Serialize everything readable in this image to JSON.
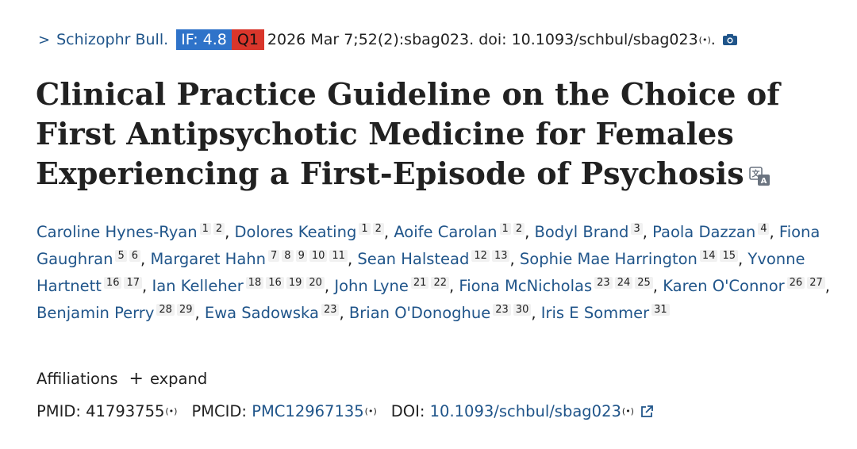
{
  "citation": {
    "chevron": ">",
    "journal": "Schizophr Bull.",
    "if_badge": "IF: 4.8",
    "q_badge": "Q1",
    "text": "2026 Mar 7;52(2):sbag023. doi: 10.1093/schbul/sbag023",
    "broadcast": "(•)",
    "trailing": "."
  },
  "title": "Clinical Practice Guideline on the Choice of First Antipsychotic Medicine for Females Experiencing a First-Episode of Psychosis",
  "authors": [
    {
      "name": "Caroline Hynes-Ryan",
      "affils": [
        "1",
        "2"
      ]
    },
    {
      "name": "Dolores Keating",
      "affils": [
        "1",
        "2"
      ]
    },
    {
      "name": "Aoife Carolan",
      "affils": [
        "1",
        "2"
      ]
    },
    {
      "name": "Bodyl Brand",
      "affils": [
        "3"
      ]
    },
    {
      "name": "Paola Dazzan",
      "affils": [
        "4"
      ]
    },
    {
      "name": "Fiona Gaughran",
      "affils": [
        "5",
        "6"
      ]
    },
    {
      "name": "Margaret Hahn",
      "affils": [
        "7",
        "8",
        "9",
        "10",
        "11"
      ]
    },
    {
      "name": "Sean Halstead",
      "affils": [
        "12",
        "13"
      ]
    },
    {
      "name": "Sophie Mae Harrington",
      "affils": [
        "14",
        "15"
      ]
    },
    {
      "name": "Yvonne Hartnett",
      "affils": [
        "16",
        "17"
      ]
    },
    {
      "name": "Ian Kelleher",
      "affils": [
        "18",
        "16",
        "19",
        "20"
      ]
    },
    {
      "name": "John Lyne",
      "affils": [
        "21",
        "22"
      ]
    },
    {
      "name": "Fiona McNicholas",
      "affils": [
        "23",
        "24",
        "25"
      ]
    },
    {
      "name": "Karen O'Connor",
      "affils": [
        "26",
        "27"
      ]
    },
    {
      "name": "Benjamin Perry",
      "affils": [
        "28",
        "29"
      ]
    },
    {
      "name": "Ewa Sadowska",
      "affils": [
        "23"
      ]
    },
    {
      "name": "Brian O'Donoghue",
      "affils": [
        "23",
        "30"
      ]
    },
    {
      "name": "Iris E Sommer",
      "affils": [
        "31"
      ]
    }
  ],
  "affiliations": {
    "label": "Affiliations",
    "expand_label": "expand",
    "plus": "+"
  },
  "ids": {
    "pmid_label": "PMID:",
    "pmid": "41793755",
    "pmcid_label": "PMCID:",
    "pmcid": "PMC12967135",
    "doi_label": "DOI:",
    "doi": "10.1093/schbul/sbag023",
    "broadcast": "(•)"
  },
  "colors": {
    "link": "#20558a",
    "if_badge": "#2f73c9",
    "q_badge": "#d9362b"
  },
  "icons": [
    "chevron-right-icon",
    "broadcast-icon",
    "camera-icon",
    "translate-icon",
    "plus-icon",
    "external-link-icon"
  ]
}
